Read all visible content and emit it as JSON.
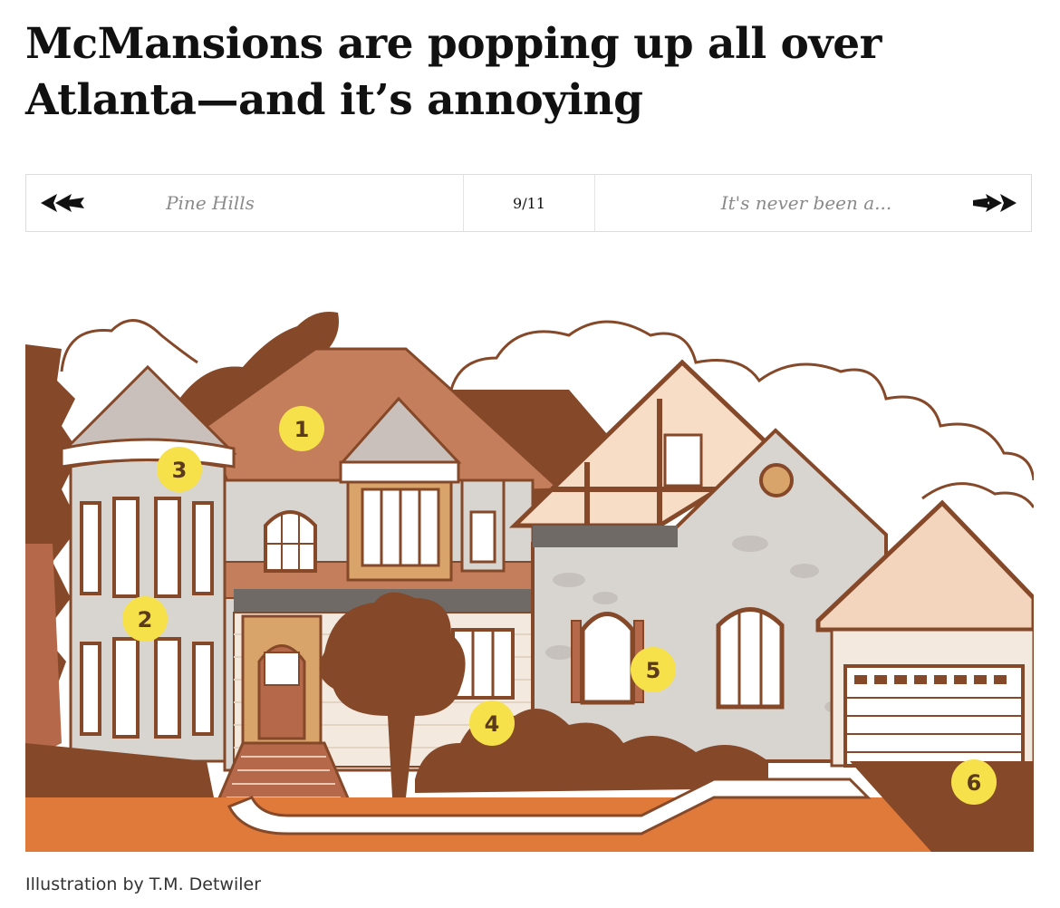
{
  "article": {
    "title": "McMansions are popping up all over Atlanta—and it’s annoying"
  },
  "slideshow": {
    "prev_label": "Pine Hills",
    "counter": "9/11",
    "next_label": "It's never been a...",
    "current": 9,
    "total": 11,
    "prev_icon": "double-arrow-left-icon",
    "next_icon": "double-arrow-right-icon"
  },
  "illustration": {
    "markers": [
      "1",
      "2",
      "3",
      "4",
      "5",
      "6"
    ],
    "colors": {
      "brown": "#85492a",
      "roof": "#c47e5c",
      "orange": "#e07a3a",
      "stone": "#d8d4d0",
      "marker": "#f6e14a"
    }
  },
  "caption": "Illustration by T.M. Detwiler"
}
